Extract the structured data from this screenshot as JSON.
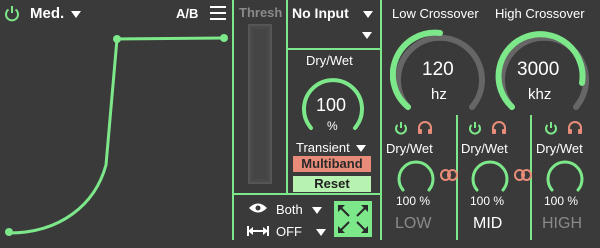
{
  "header": {
    "mode_label": "Med.",
    "ab_label": "A/B"
  },
  "thresh": {
    "label": "Thresh"
  },
  "input": {
    "selected": "No Input"
  },
  "main_drywet": {
    "label": "Dry/Wet",
    "value": "100",
    "unit": "%",
    "level_fraction": 1.0
  },
  "transient": {
    "label": "Transient"
  },
  "buttons": {
    "multiband": "Multiband",
    "reset": "Reset"
  },
  "footer": {
    "view_mode": "Both",
    "link_mode": "OFF"
  },
  "crossover": {
    "low_label": "Low Crossover",
    "high_label": "High Crossover",
    "low_value": "120",
    "low_unit": "hz",
    "high_value": "3000",
    "high_unit": "khz"
  },
  "bands": [
    {
      "drywet_label": "Dry/Wet",
      "value": "100 %",
      "name": "LOW"
    },
    {
      "drywet_label": "Dry/Wet",
      "value": "100 %",
      "name": "MID"
    },
    {
      "drywet_label": "Dry/Wet",
      "value": "100 %",
      "name": "HIGH"
    }
  ],
  "colors": {
    "accent": "#7de88a",
    "background": "#3a3a3a",
    "solo": "#e88c79",
    "knob_track": "#666666"
  }
}
